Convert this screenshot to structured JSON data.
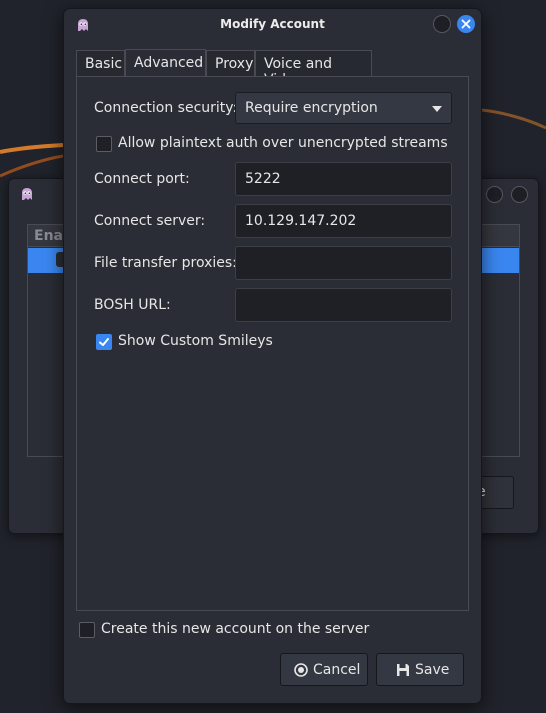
{
  "dialog": {
    "title": "Modify Account"
  },
  "tabs": [
    {
      "label": "Basic",
      "active": false
    },
    {
      "label": "Advanced",
      "active": true
    },
    {
      "label": "Proxy",
      "active": false
    },
    {
      "label": "Voice and Video",
      "active": false
    }
  ],
  "advanced": {
    "connection_security_label": "Connection security:",
    "connection_security_value": "Require encryption",
    "allow_plaintext_label": "Allow plaintext auth over unencrypted streams",
    "allow_plaintext_checked": false,
    "connect_port_label": "Connect port:",
    "connect_port_value": "5222",
    "connect_server_label": "Connect server:",
    "connect_server_value": "10.129.147.202",
    "file_transfer_label": "File transfer proxies:",
    "file_transfer_value": "",
    "bosh_url_label": "BOSH URL:",
    "bosh_url_value": "",
    "show_smileys_label": "Show Custom Smileys",
    "show_smileys_checked": true
  },
  "footer": {
    "create_account_label": "Create this new account on the server",
    "create_account_checked": false,
    "cancel_label": "Cancel",
    "save_label": "Save"
  },
  "background_window": {
    "list_header": "Enal",
    "button_fragment": "e"
  },
  "colors": {
    "accent": "#3a86f0",
    "window_bg": "#2a2d35",
    "desktop_swoosh": "#e8842a"
  },
  "icons": {
    "app": "pidgin-icon",
    "close": "close-icon",
    "cancel": "cancel-icon",
    "save": "save-icon",
    "dropdown": "chevron-down-icon"
  }
}
